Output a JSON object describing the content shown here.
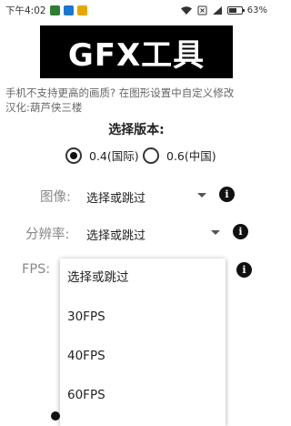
{
  "status_bar": {
    "time": "下午4:02",
    "battery": "63%",
    "battery_level": 0.63,
    "colors": {
      "app1": "#2e7d32",
      "app2": "#1976d2",
      "app3": "#e6a700"
    }
  },
  "banner": {
    "title": "GFX工具"
  },
  "hint": {
    "line1": "手机不支持更高的画质? 在图形设置中自定义修改",
    "line2": "汉化:葫芦侠三楼"
  },
  "version": {
    "title": "选择版本:",
    "options": [
      {
        "label": "0.4(国际)",
        "selected": true
      },
      {
        "label": "0.6(中国)",
        "selected": false
      }
    ]
  },
  "fields": {
    "graphics": {
      "label": "图像:",
      "value": "选择或跳过"
    },
    "resolution": {
      "label": "分辨率:",
      "value": "选择或跳过"
    },
    "fps": {
      "label": "FPS:"
    }
  },
  "fps_dropdown": {
    "options": [
      "选择或跳过",
      "30FPS",
      "40FPS",
      "60FPS"
    ]
  }
}
